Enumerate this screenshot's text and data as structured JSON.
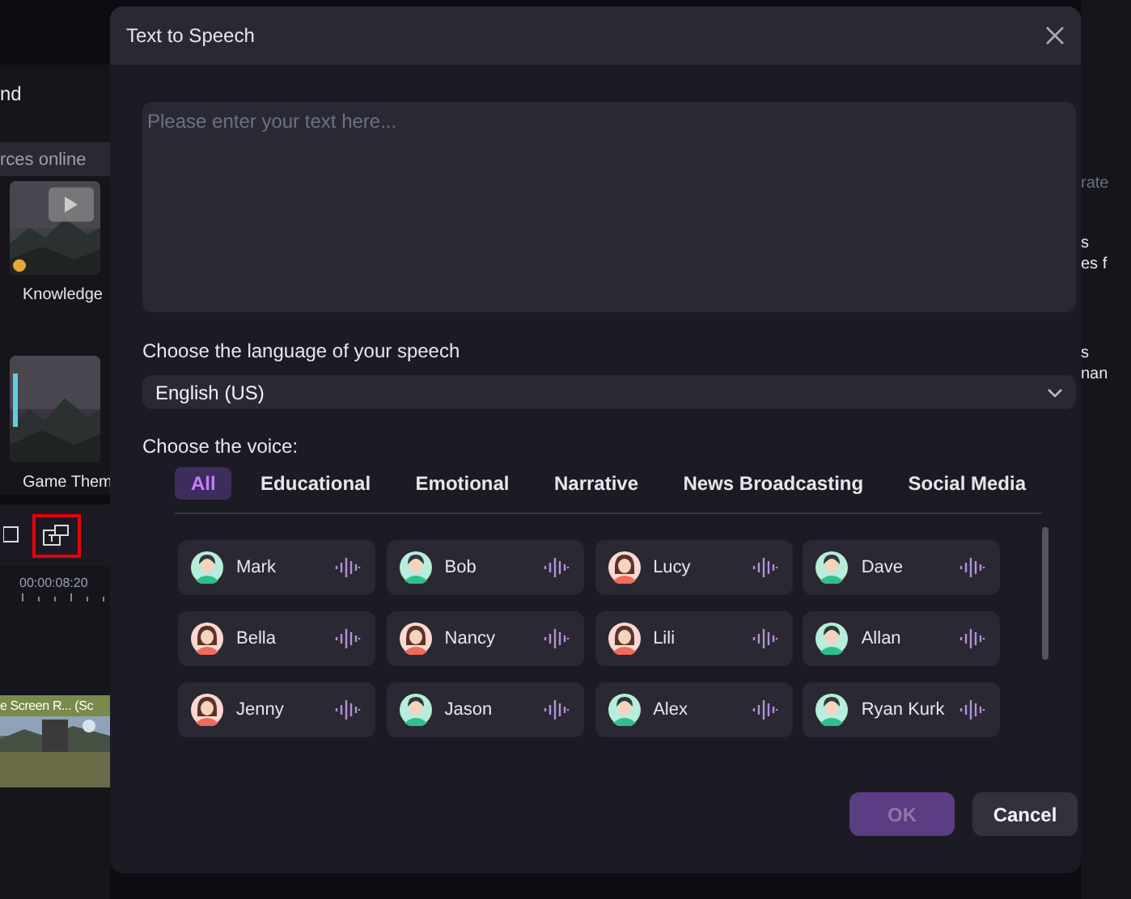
{
  "background": {
    "panel_title": "nd",
    "search": {
      "placeholder": "rces online"
    },
    "media": [
      {
        "label": "Knowledge",
        "kind": "picture"
      },
      {
        "label": "Game Them",
        "kind": "picture"
      }
    ],
    "timecode": "00:00:08:20",
    "clip": {
      "label": "e Screen R... (Sc"
    },
    "right_fragments": [
      "rate",
      "s",
      "es f",
      "s",
      "nan"
    ]
  },
  "dialog": {
    "title": "Text to Speech",
    "text_input": {
      "placeholder": "Please enter your text here..."
    },
    "language_label": "Choose the language of your speech",
    "language": {
      "value": "English (US)"
    },
    "voice_label": "Choose the voice:",
    "tabs": [
      {
        "label": "All",
        "selected": true
      },
      {
        "label": "Educational",
        "selected": false
      },
      {
        "label": "Emotional",
        "selected": false
      },
      {
        "label": "Narrative",
        "selected": false
      },
      {
        "label": "News Broadcasting",
        "selected": false
      },
      {
        "label": "Social Media",
        "selected": false
      }
    ],
    "voices": [
      {
        "name": "Mark",
        "kind": "male"
      },
      {
        "name": "Bob",
        "kind": "male"
      },
      {
        "name": "Lucy",
        "kind": "female"
      },
      {
        "name": "Dave",
        "kind": "male"
      },
      {
        "name": "Bella",
        "kind": "female"
      },
      {
        "name": "Nancy",
        "kind": "female"
      },
      {
        "name": "Lili",
        "kind": "female"
      },
      {
        "name": "Allan",
        "kind": "male"
      },
      {
        "name": "Jenny",
        "kind": "female"
      },
      {
        "name": "Jason",
        "kind": "male"
      },
      {
        "name": "Alex",
        "kind": "male"
      },
      {
        "name": "Ryan Kurk",
        "kind": "male"
      }
    ],
    "buttons": [
      {
        "label": "OK",
        "kind": "primary",
        "disabled": true
      },
      {
        "label": "Cancel",
        "kind": "secondary",
        "disabled": false
      }
    ]
  }
}
